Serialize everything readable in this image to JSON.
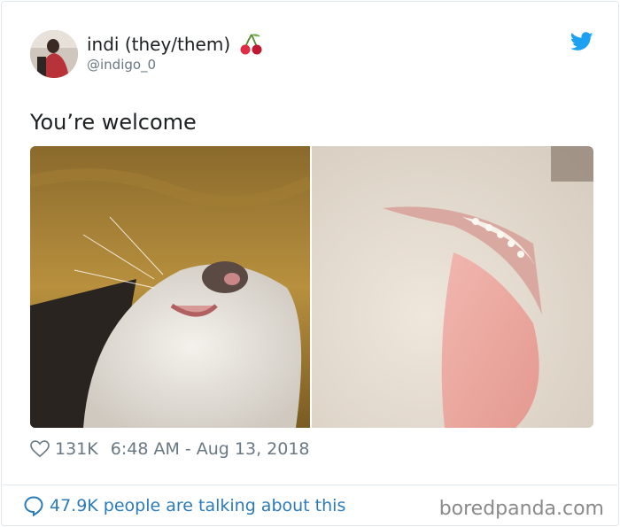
{
  "user": {
    "display_name": "indi (they/them)",
    "handle": "@indigo_0",
    "emoji_icon": "cherries-icon"
  },
  "tweet": {
    "text": "You’re welcome",
    "likes": "131K",
    "timestamp": "6:48 AM - Aug 13, 2018"
  },
  "footer": {
    "talking_text": "47.9K people are talking about this",
    "watermark": "boredpanda.com"
  },
  "colors": {
    "link": "#2b7bb9",
    "twitter_blue": "#1da1f2",
    "muted": "#697882"
  }
}
